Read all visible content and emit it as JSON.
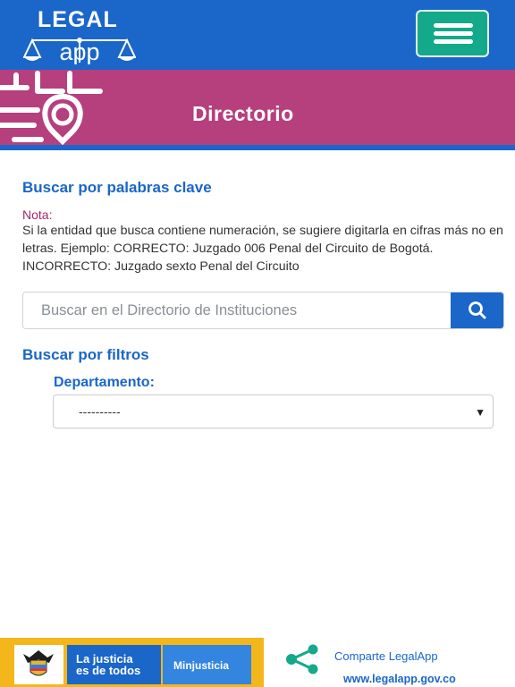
{
  "header": {
    "logo_top": "LEGAL",
    "logo_bottom": "app",
    "menu_icon": "hamburger-menu-icon",
    "color": "#1a66c9",
    "menu_color": "#14a98a"
  },
  "banner": {
    "title": "Directorio",
    "color": "#b63f7d"
  },
  "keyword_search": {
    "title": "Buscar por palabras clave",
    "note_label": "Nota:",
    "note_text": "Si la entidad que busca contiene numeración, se sugiere digitarla en cifras más no en letras. Ejemplo: CORRECTO: Juzgado 006 Penal del Circuito de Bogotá. INCORRECTO: Juzgado sexto Penal del Circuito",
    "placeholder": "Buscar en el Directorio de Instituciones",
    "value": "",
    "search_icon": "search-icon"
  },
  "filters": {
    "title": "Buscar por filtros",
    "department_label": "Departamento:",
    "department_selected": "----------",
    "arrow": "▼"
  },
  "footer": {
    "brand_line1": "La justicia",
    "brand_line2": "es de todos",
    "ministry": "Minjusticia",
    "share_label": "Comparte LegalApp",
    "share_icon": "share-icon",
    "site": "www.legalapp.gov.co",
    "brand_color": "#f3b71c",
    "share_color": "#14a98a"
  }
}
